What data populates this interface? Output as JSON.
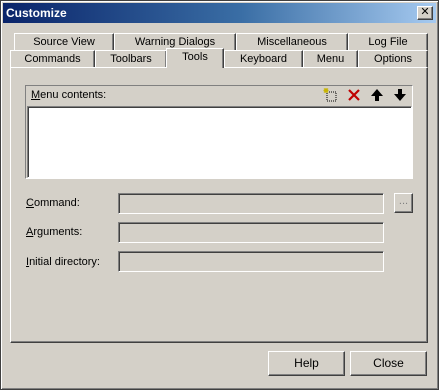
{
  "window": {
    "title": "Customize",
    "close_symbol": "✕"
  },
  "tabs_row1": [
    "Source View",
    "Warning Dialogs",
    "Miscellaneous",
    "Log File"
  ],
  "tabs_row2": [
    "Commands",
    "Toolbars",
    "Tools",
    "Keyboard",
    "Menu",
    "Options"
  ],
  "active_tab": "Tools",
  "menu_contents": {
    "label_underline": "M",
    "label_rest": "enu contents:",
    "toolbar": [
      "new-item-icon",
      "delete-icon",
      "move-up-icon",
      "move-down-icon"
    ],
    "items": []
  },
  "fields": {
    "command": {
      "underline": "C",
      "rest": "ommand:",
      "value": ""
    },
    "arguments": {
      "underline": "A",
      "rest": "rguments:",
      "value": ""
    },
    "initial_directory": {
      "underline": "I",
      "rest": "nitial directory:",
      "value": ""
    },
    "browse_label": "..."
  },
  "buttons": {
    "help": "Help",
    "close": "Close"
  },
  "colors": {
    "title_start": "#0a246a",
    "title_end": "#a6caf0",
    "face": "#d4d0c8",
    "delete_red": "#c00000"
  }
}
